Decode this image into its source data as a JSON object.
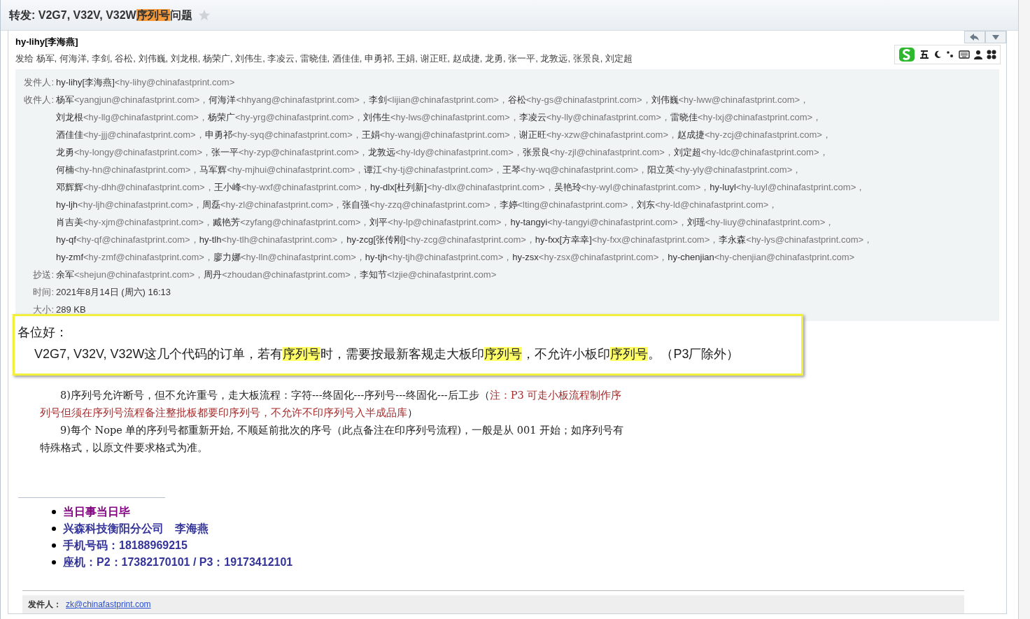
{
  "title": {
    "parts": [
      {
        "text": "转发: V2G7, V32V, V32W",
        "highlighted": false
      },
      {
        "text": "序列号",
        "highlighted": true
      },
      {
        "text": "问题",
        "highlighted": false
      }
    ],
    "starred": false
  },
  "header": {
    "sender_name": "hy-lihy[李海燕]",
    "sent_to": "发给 杨军, 何海洋, 李剑, 谷松, 刘伟巍, 刘龙根, 杨荣广, 刘伟生, 李凌云, 雷晓佳, 酒佳佳, 申勇祁, 王娟, 谢正旺, 赵成捷, 龙勇, 张一平, 龙敦远, 张景良, 刘定超"
  },
  "details": {
    "from": {
      "label": "发件人:",
      "lines": [
        [
          {
            "name": "hy-lihy[李海燕]",
            "email": "<hy-lihy@chinafastprint.com>"
          }
        ]
      ]
    },
    "to": {
      "label": "收件人:",
      "lines": [
        [
          {
            "name": "杨军",
            "email": "<yangjun@chinafastprint.com>，"
          },
          {
            "name": "何海洋",
            "email": "<hhyang@chinafastprint.com>，"
          },
          {
            "name": "李剑",
            "email": "<lijian@chinafastprint.com>，"
          },
          {
            "name": "谷松",
            "email": "<hy-gs@chinafastprint.com>，"
          },
          {
            "name": "刘伟巍",
            "email": "<hy-lww@chinafastprint.com>，"
          }
        ],
        [
          {
            "name": "刘龙根",
            "email": "<hy-llg@chinafastprint.com>，"
          },
          {
            "name": "杨荣广",
            "email": "<hy-yrg@chinafastprint.com>，"
          },
          {
            "name": "刘伟生",
            "email": "<hy-lws@chinafastprint.com>，"
          },
          {
            "name": "李凌云",
            "email": "<hy-lly@chinafastprint.com>，"
          },
          {
            "name": "雷晓佳",
            "email": "<hy-lxj@chinafastprint.com>，"
          }
        ],
        [
          {
            "name": "酒佳佳",
            "email": "<hy-jjj@chinafastprint.com>，"
          },
          {
            "name": "申勇祁",
            "email": "<hy-syq@chinafastprint.com>，"
          },
          {
            "name": "王娟",
            "email": "<hy-wangj@chinafastprint.com>，"
          },
          {
            "name": "谢正旺",
            "email": "<hy-xzw@chinafastprint.com>，"
          },
          {
            "name": "赵成捷",
            "email": "<hy-zcj@chinafastprint.com>，"
          }
        ],
        [
          {
            "name": "龙勇",
            "email": "<hy-longy@chinafastprint.com>，"
          },
          {
            "name": "张一平",
            "email": "<hy-zyp@chinafastprint.com>，"
          },
          {
            "name": "龙敦远",
            "email": "<hy-ldy@chinafastprint.com>，"
          },
          {
            "name": "张景良",
            "email": "<hy-zjl@chinafastprint.com>，"
          },
          {
            "name": "刘定超",
            "email": "<hy-ldc@chinafastprint.com>，"
          }
        ],
        [
          {
            "name": "何楠",
            "email": "<hy-hn@chinafastprint.com>，"
          },
          {
            "name": "马军辉",
            "email": "<hy-mjhui@chinafastprint.com>，"
          },
          {
            "name": "谭江",
            "email": "<hy-tj@chinafastprint.com>，"
          },
          {
            "name": "王琴",
            "email": "<hy-wq@chinafastprint.com>，"
          },
          {
            "name": "阳立英",
            "email": "<hy-yly@chinafastprint.com>，"
          }
        ],
        [
          {
            "name": "邓辉辉",
            "email": "<hy-dhh@chinafastprint.com>，"
          },
          {
            "name": "王小峰",
            "email": "<hy-wxf@chinafastprint.com>，"
          },
          {
            "name": "hy-dlx[杜列新]",
            "email": "<hy-dlx@chinafastprint.com>，"
          },
          {
            "name": "吴艳玲",
            "email": "<hy-wyl@chinafastprint.com>，"
          },
          {
            "name": "hy-luyl",
            "email": "<hy-luyl@chinafastprint.com>，"
          }
        ],
        [
          {
            "name": "hy-ljh",
            "email": "<hy-ljh@chinafastprint.com>，"
          },
          {
            "name": "周磊",
            "email": "<hy-zl@chinafastprint.com>，"
          },
          {
            "name": "张自强",
            "email": "<hy-zzq@chinafastprint.com>，"
          },
          {
            "name": "李婷",
            "email": "<lting@chinafastprint.com>，"
          },
          {
            "name": "刘东",
            "email": "<hy-ld@chinafastprint.com>，"
          }
        ],
        [
          {
            "name": "肖吉美",
            "email": "<hy-xjm@chinafastprint.com>，"
          },
          {
            "name": "臧艳芳",
            "email": "<zyfang@chinafastprint.com>，"
          },
          {
            "name": "刘平",
            "email": "<hy-lp@chinafastprint.com>，"
          },
          {
            "name": "hy-tangyi",
            "email": "<hy-tangyi@chinafastprint.com>，"
          },
          {
            "name": "刘瑶",
            "email": "<hy-liuy@chinafastprint.com>，"
          }
        ],
        [
          {
            "name": "hy-qf",
            "email": "<hy-qf@chinafastprint.com>，"
          },
          {
            "name": "hy-tlh",
            "email": "<hy-tlh@chinafastprint.com>，"
          },
          {
            "name": "hy-zcg[张传刚]",
            "email": "<hy-zcg@chinafastprint.com>，"
          },
          {
            "name": "hy-fxx[方幸幸]",
            "email": "<hy-fxx@chinafastprint.com>，"
          },
          {
            "name": "李永森",
            "email": "<hy-lys@chinafastprint.com>，"
          }
        ],
        [
          {
            "name": "hy-zmf",
            "email": "<hy-zmf@chinafastprint.com>，"
          },
          {
            "name": "廖力娜",
            "email": "<hy-lln@chinafastprint.com>，"
          },
          {
            "name": "hy-tjh",
            "email": "<hy-tjh@chinafastprint.com>，"
          },
          {
            "name": "hy-zsx",
            "email": "<hy-zsx@chinafastprint.com>，"
          },
          {
            "name": "hy-chenjian",
            "email": "<hy-chenjian@chinafastprint.com>"
          }
        ]
      ]
    },
    "cc": {
      "label": "抄送:",
      "lines": [
        [
          {
            "name": "余军",
            "email": "<shejun@chinafastprint.com>，"
          },
          {
            "name": "周丹",
            "email": "<zhoudan@chinafastprint.com>，"
          },
          {
            "name": "李知节",
            "email": "<lzjie@chinafastprint.com>"
          }
        ]
      ]
    },
    "time": {
      "label": "时间:",
      "value": "2021年8月14日 (周六) 16:13"
    },
    "size": {
      "label": "大小:",
      "value": "289 KB"
    }
  },
  "notice": {
    "greeting": "各位好：",
    "parts": [
      {
        "text": "V2G7, V32V, V32W这几个代码的订单，若有",
        "highlighted": false
      },
      {
        "text": "序列号",
        "highlighted": true
      },
      {
        "text": "时，需要按最新客规走大板印",
        "highlighted": false
      },
      {
        "text": "序列号",
        "highlighted": true
      },
      {
        "text": "，不允许小板印",
        "highlighted": false
      },
      {
        "text": "序列号",
        "highlighted": true
      },
      {
        "text": "。（P3厂除外）",
        "highlighted": false
      }
    ]
  },
  "rules": [
    {
      "parts": [
        {
          "text": "8)序列号允许断号，但不允许重号，走大板流程：字符---终固化---序列号---终固化---后工步（",
          "note": false
        },
        {
          "text": "注：P3 可走小板流程制作序列号但须在序列号流程备注整批板都要印序列号，不允许不印序列号入半成品库",
          "note": true
        },
        {
          "text": "）",
          "note": false
        }
      ]
    },
    {
      "parts": [
        {
          "text": "9)每个 Nope 单的序列号都重新开始, 不顺延前批次的序号（此点备注在印序列号流程)，一般是从 001 开始；如序列号有特殊格式，以原文件要求格式为准。",
          "note": false
        }
      ]
    }
  ],
  "signature": [
    {
      "text": "当日事当日毕",
      "color": "#800080"
    },
    {
      "text": "兴森科技衡阳分公司　李海燕",
      "color": "#333399"
    },
    {
      "text": "手机号码：18188969215",
      "color": "#333399"
    },
    {
      "text": "座机：P2：17382170101 / P3：19173412101",
      "color": "#333399"
    }
  ],
  "quoted": {
    "label": "发件人：",
    "email": "zk@chinafastprint.com"
  }
}
